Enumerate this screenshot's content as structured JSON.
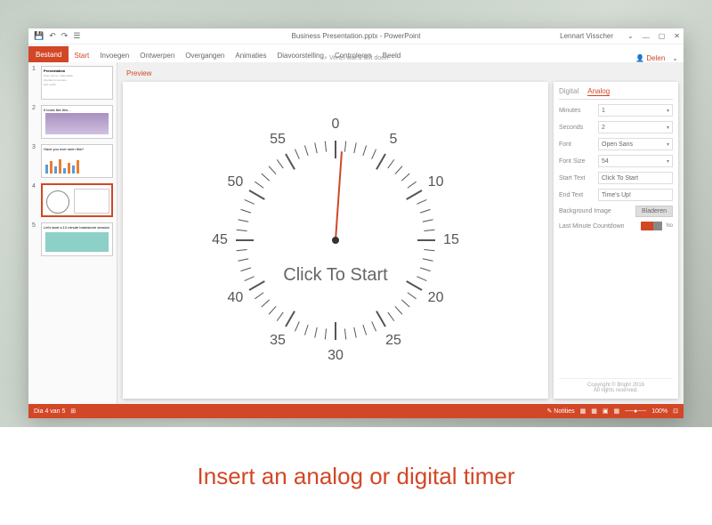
{
  "title": "Business Presentation.pptx - PowerPoint",
  "user": "Lennart Visscher",
  "qat": [
    "💾",
    "↶",
    "↷",
    "☰"
  ],
  "win": [
    "⎼",
    "▢",
    "✕"
  ],
  "file_tab": "Bestand",
  "tabs": [
    "Start",
    "Invoegen",
    "Ontwerpen",
    "Overgangen",
    "Animaties",
    "Diavoorstelling",
    "Controleren",
    "Beeld"
  ],
  "tell_me": "⌕ Vertel wat u wilt doen",
  "share": "Delen",
  "thumbs": [
    {
      "n": "1",
      "title": "Presentation"
    },
    {
      "n": "2",
      "title": "It looks like this..."
    },
    {
      "n": "3",
      "title": "Have you ever seen this?"
    },
    {
      "n": "4",
      "title": ""
    },
    {
      "n": "5",
      "title": "Let's start a 10 minute brainstorm session"
    }
  ],
  "preview_label": "Preview",
  "clock_numbers": [
    "0",
    "5",
    "10",
    "15",
    "20",
    "25",
    "30",
    "35",
    "40",
    "45",
    "50",
    "55"
  ],
  "clock_text": "Click To Start",
  "panel": {
    "tabs": [
      "Digital",
      "Analog"
    ],
    "rows": {
      "minutes": {
        "label": "Minutes",
        "value": "1"
      },
      "seconds": {
        "label": "Seconds",
        "value": "2"
      },
      "font": {
        "label": "Font",
        "value": "Open Sans"
      },
      "fontsize": {
        "label": "Font Size",
        "value": "54"
      },
      "starttext": {
        "label": "Start Text",
        "value": "Click To Start"
      },
      "endtext": {
        "label": "End Text",
        "value": "Time's Up!"
      },
      "bg": {
        "label": "Background Image",
        "button": "Bladeren"
      },
      "countdown": {
        "label": "Last Minute Countdown",
        "toggle": "No"
      }
    },
    "footer1": "Copyright © Bright 2016",
    "footer2": "All rights reserved."
  },
  "status_left": "Dia 4 van 5",
  "status_notes": "Notities",
  "status_zoom": "100%",
  "caption": "Insert an analog or digital timer"
}
